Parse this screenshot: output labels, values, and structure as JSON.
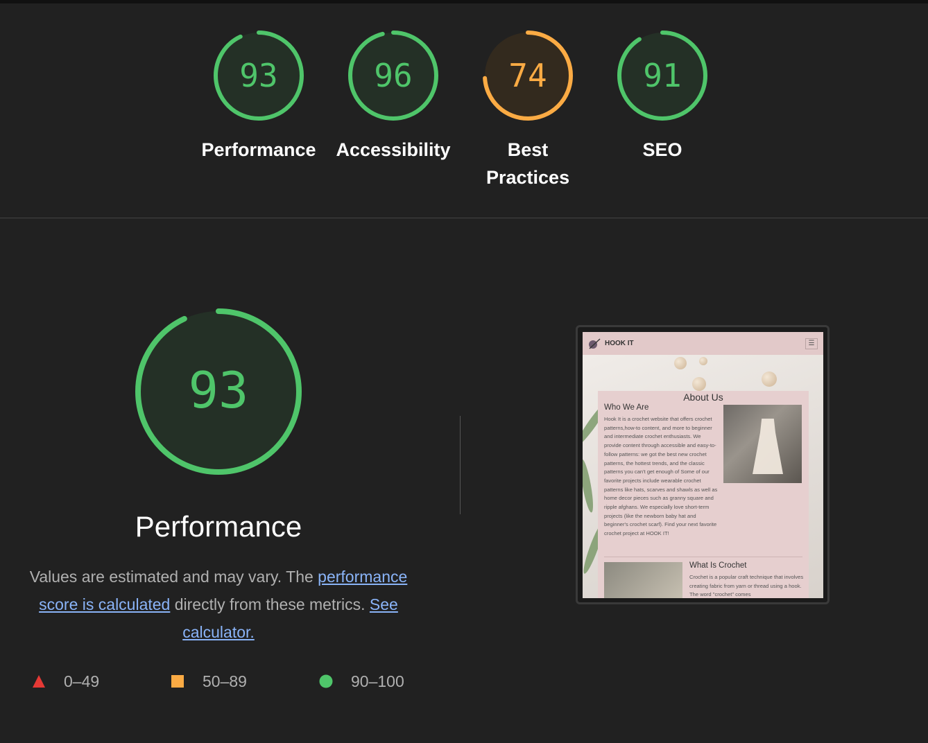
{
  "scores": [
    {
      "label": "Performance",
      "value": "93",
      "score": 93,
      "status": "pass"
    },
    {
      "label": "Accessibility",
      "value": "96",
      "score": 96,
      "status": "pass"
    },
    {
      "label": "Best Practices",
      "value": "74",
      "score": 74,
      "status": "average"
    },
    {
      "label": "SEO",
      "value": "91",
      "score": 91,
      "status": "pass"
    }
  ],
  "category": {
    "title": "Performance",
    "value": "93",
    "score": 93,
    "description_before": "Values are estimated and may vary. The ",
    "link_calc": "performance score is calculated",
    "description_middle": " directly from these metrics. ",
    "link_calculator": "See calculator."
  },
  "legend": [
    {
      "label": "0–49",
      "shape": "triangle",
      "color": "#e53935"
    },
    {
      "label": "50–89",
      "shape": "square",
      "color": "#fbab44"
    },
    {
      "label": "90–100",
      "shape": "circle",
      "color": "#4fc56a"
    }
  ],
  "colors": {
    "pass": "#4fc56a",
    "pass_bg": "#243026",
    "average": "#fbab44",
    "average_bg": "#332a1e",
    "fail": "#e53935"
  },
  "screenshot": {
    "brand": "HOOK IT",
    "menu_icon": "hamburger-icon",
    "about_title": "About Us",
    "who_title": "Who We Are",
    "who_text": "Hook It is a crochet website that offers crochet patterns,how-to content, and more to beginner and intermediate crochet enthusiasts. We provide content through accessible and easy-to-follow patterns: we got the best new crochet patterns, the hottest trends, and the classic patterns you can't get enough of Some of our favorite projects include wearable crochet patterns like hats, scarves and shawls as well as home decor pieces such as granny square and ripple afghans. We especially love short-term projects (like the newborn baby hat and beginner's crochet scarf). Find your next favorite crochet project at HOOK IT!",
    "what_title": "What Is Crochet",
    "what_text": "Crochet is a popular craft technique that involves creating fabric from yarn or thread using a hook. The word \"crochet\" comes"
  }
}
